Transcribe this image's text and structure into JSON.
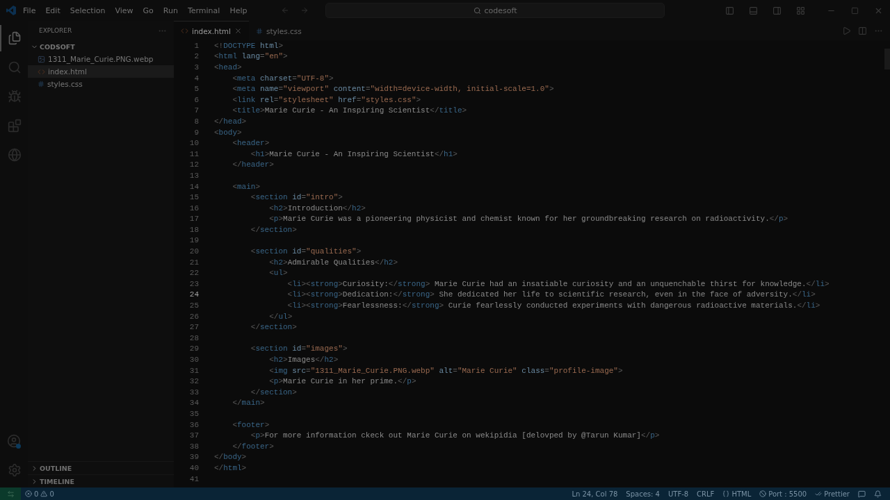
{
  "window": {
    "menu": [
      "File",
      "Edit",
      "Selection",
      "View",
      "Go",
      "Run",
      "Terminal",
      "Help"
    ],
    "search": "codesoft"
  },
  "activity_bar": [
    {
      "kind": "files",
      "selected": true
    },
    {
      "kind": "search",
      "selected": false
    },
    {
      "kind": "debug",
      "selected": false
    },
    {
      "kind": "extensions",
      "selected": false
    },
    {
      "kind": "browser",
      "selected": false
    }
  ],
  "sidebar": {
    "title": "EXPLORER",
    "folder": {
      "name": "CODSOFT",
      "expanded": true,
      "children": [
        {
          "name": "1311_Marie_Curie.PNG.webp",
          "kind": "image",
          "selected": false
        },
        {
          "name": "index.html",
          "kind": "html",
          "selected": true
        },
        {
          "name": "styles.css",
          "kind": "css",
          "selected": false
        }
      ]
    },
    "sections": [
      {
        "name": "OUTLINE",
        "expanded": false
      },
      {
        "name": "TIMELINE",
        "expanded": false
      }
    ]
  },
  "tabs": [
    {
      "label": "index.html",
      "kind": "html",
      "selected": true
    },
    {
      "label": "styles.css",
      "kind": "css",
      "selected": false
    }
  ],
  "editor": {
    "lines": [
      {
        "number": "1",
        "current": false,
        "tokens": [
          {
            "kind": "punct",
            "text": "<!"
          },
          {
            "kind": "tag",
            "text": "DOCTYPE"
          },
          {
            "kind": "attr",
            "text": " html"
          },
          {
            "kind": "punct",
            "text": ">"
          }
        ]
      },
      {
        "number": "2",
        "current": false,
        "tokens": [
          {
            "kind": "punct",
            "text": "<"
          },
          {
            "kind": "tag",
            "text": "html"
          },
          {
            "kind": "attr",
            "text": " lang"
          },
          {
            "kind": "punct",
            "text": "="
          },
          {
            "kind": "string",
            "text": "\"en\""
          },
          {
            "kind": "punct",
            "text": ">"
          }
        ]
      },
      {
        "number": "3",
        "current": false,
        "tokens": [
          {
            "kind": "punct",
            "text": "<"
          },
          {
            "kind": "tag",
            "text": "head"
          },
          {
            "kind": "punct",
            "text": ">"
          }
        ]
      },
      {
        "number": "4",
        "current": false,
        "tokens": [
          {
            "kind": "punct",
            "text": "    <"
          },
          {
            "kind": "tag",
            "text": "meta"
          },
          {
            "kind": "attr",
            "text": " charset"
          },
          {
            "kind": "punct",
            "text": "="
          },
          {
            "kind": "string",
            "text": "\"UTF-8\""
          },
          {
            "kind": "punct",
            "text": ">"
          }
        ]
      },
      {
        "number": "5",
        "current": false,
        "tokens": [
          {
            "kind": "punct",
            "text": "    <"
          },
          {
            "kind": "tag",
            "text": "meta"
          },
          {
            "kind": "attr",
            "text": " name"
          },
          {
            "kind": "punct",
            "text": "="
          },
          {
            "kind": "string",
            "text": "\"viewport\""
          },
          {
            "kind": "attr",
            "text": " content"
          },
          {
            "kind": "punct",
            "text": "="
          },
          {
            "kind": "string",
            "text": "\"width=device-width, initial-scale=1.0\""
          },
          {
            "kind": "punct",
            "text": ">"
          }
        ]
      },
      {
        "number": "6",
        "current": false,
        "tokens": [
          {
            "kind": "punct",
            "text": "    <"
          },
          {
            "kind": "tag",
            "text": "link"
          },
          {
            "kind": "attr",
            "text": " rel"
          },
          {
            "kind": "punct",
            "text": "="
          },
          {
            "kind": "string",
            "text": "\"stylesheet\""
          },
          {
            "kind": "attr",
            "text": " href"
          },
          {
            "kind": "punct",
            "text": "="
          },
          {
            "kind": "string",
            "text": "\"styles.css\""
          },
          {
            "kind": "punct",
            "text": ">"
          }
        ]
      },
      {
        "number": "7",
        "current": false,
        "tokens": [
          {
            "kind": "punct",
            "text": "    <"
          },
          {
            "kind": "tag",
            "text": "title"
          },
          {
            "kind": "punct",
            "text": ">"
          },
          {
            "kind": "text",
            "text": "Marie Curie - An Inspiring Scientist"
          },
          {
            "kind": "punct",
            "text": "</"
          },
          {
            "kind": "tag",
            "text": "title"
          },
          {
            "kind": "punct",
            "text": ">"
          }
        ]
      },
      {
        "number": "8",
        "current": false,
        "tokens": [
          {
            "kind": "punct",
            "text": "</"
          },
          {
            "kind": "tag",
            "text": "head"
          },
          {
            "kind": "punct",
            "text": ">"
          }
        ]
      },
      {
        "number": "9",
        "current": false,
        "tokens": [
          {
            "kind": "punct",
            "text": "<"
          },
          {
            "kind": "tag",
            "text": "body"
          },
          {
            "kind": "punct",
            "text": ">"
          }
        ]
      },
      {
        "number": "10",
        "current": false,
        "tokens": [
          {
            "kind": "punct",
            "text": "    <"
          },
          {
            "kind": "tag",
            "text": "header"
          },
          {
            "kind": "punct",
            "text": ">"
          }
        ]
      },
      {
        "number": "11",
        "current": false,
        "tokens": [
          {
            "kind": "punct",
            "text": "        <"
          },
          {
            "kind": "tag",
            "text": "h1"
          },
          {
            "kind": "punct",
            "text": ">"
          },
          {
            "kind": "text",
            "text": "Marie Curie - An Inspiring Scientist"
          },
          {
            "kind": "punct",
            "text": "</"
          },
          {
            "kind": "tag",
            "text": "h1"
          },
          {
            "kind": "punct",
            "text": ">"
          }
        ]
      },
      {
        "number": "12",
        "current": false,
        "tokens": [
          {
            "kind": "punct",
            "text": "    </"
          },
          {
            "kind": "tag",
            "text": "header"
          },
          {
            "kind": "punct",
            "text": ">"
          }
        ]
      },
      {
        "number": "13",
        "current": false
      },
      {
        "number": "14",
        "current": false,
        "tokens": [
          {
            "kind": "punct",
            "text": "    <"
          },
          {
            "kind": "tag",
            "text": "main"
          },
          {
            "kind": "punct",
            "text": ">"
          }
        ]
      },
      {
        "number": "15",
        "current": false,
        "tokens": [
          {
            "kind": "punct",
            "text": "        <"
          },
          {
            "kind": "tag",
            "text": "section"
          },
          {
            "kind": "attr",
            "text": " id"
          },
          {
            "kind": "punct",
            "text": "="
          },
          {
            "kind": "string",
            "text": "\"intro\""
          },
          {
            "kind": "punct",
            "text": ">"
          }
        ]
      },
      {
        "number": "16",
        "current": false,
        "tokens": [
          {
            "kind": "punct",
            "text": "            <"
          },
          {
            "kind": "tag",
            "text": "h2"
          },
          {
            "kind": "punct",
            "text": ">"
          },
          {
            "kind": "text",
            "text": "Introduction"
          },
          {
            "kind": "punct",
            "text": "</"
          },
          {
            "kind": "tag",
            "text": "h2"
          },
          {
            "kind": "punct",
            "text": ">"
          }
        ]
      },
      {
        "number": "17",
        "current": false,
        "tokens": [
          {
            "kind": "punct",
            "text": "            <"
          },
          {
            "kind": "tag",
            "text": "p"
          },
          {
            "kind": "punct",
            "text": ">"
          },
          {
            "kind": "text",
            "text": "Marie Curie was a pioneering physicist and chemist known for her groundbreaking research on radioactivity."
          },
          {
            "kind": "punct",
            "text": "</"
          },
          {
            "kind": "tag",
            "text": "p"
          },
          {
            "kind": "punct",
            "text": ">"
          }
        ]
      },
      {
        "number": "18",
        "current": false,
        "tokens": [
          {
            "kind": "punct",
            "text": "        </"
          },
          {
            "kind": "tag",
            "text": "section"
          },
          {
            "kind": "punct",
            "text": ">"
          }
        ]
      },
      {
        "number": "19",
        "current": false
      },
      {
        "number": "20",
        "current": false,
        "tokens": [
          {
            "kind": "punct",
            "text": "        <"
          },
          {
            "kind": "tag",
            "text": "section"
          },
          {
            "kind": "attr",
            "text": " id"
          },
          {
            "kind": "punct",
            "text": "="
          },
          {
            "kind": "string",
            "text": "\"qualities\""
          },
          {
            "kind": "punct",
            "text": ">"
          }
        ]
      },
      {
        "number": "21",
        "current": false,
        "tokens": [
          {
            "kind": "punct",
            "text": "            <"
          },
          {
            "kind": "tag",
            "text": "h2"
          },
          {
            "kind": "punct",
            "text": ">"
          },
          {
            "kind": "text",
            "text": "Admirable Qualities"
          },
          {
            "kind": "punct",
            "text": "</"
          },
          {
            "kind": "tag",
            "text": "h2"
          },
          {
            "kind": "punct",
            "text": ">"
          }
        ]
      },
      {
        "number": "22",
        "current": false,
        "tokens": [
          {
            "kind": "punct",
            "text": "            <"
          },
          {
            "kind": "tag",
            "text": "ul"
          },
          {
            "kind": "punct",
            "text": ">"
          }
        ]
      },
      {
        "number": "23",
        "current": false,
        "tokens": [
          {
            "kind": "punct",
            "text": "                <"
          },
          {
            "kind": "tag",
            "text": "li"
          },
          {
            "kind": "punct",
            "text": "><"
          },
          {
            "kind": "tag",
            "text": "strong"
          },
          {
            "kind": "punct",
            "text": ">"
          },
          {
            "kind": "text",
            "text": "Curiosity:"
          },
          {
            "kind": "punct",
            "text": "</"
          },
          {
            "kind": "tag",
            "text": "strong"
          },
          {
            "kind": "punct",
            "text": ">"
          },
          {
            "kind": "text",
            "text": " Marie Curie had an insatiable curiosity and an unquenchable thirst for knowledge."
          },
          {
            "kind": "punct",
            "text": "</"
          },
          {
            "kind": "tag",
            "text": "li"
          },
          {
            "kind": "punct",
            "text": ">"
          }
        ]
      },
      {
        "number": "24",
        "current": true,
        "tokens": [
          {
            "kind": "punct",
            "text": "                <"
          },
          {
            "kind": "tag",
            "text": "li"
          },
          {
            "kind": "punct",
            "text": "><"
          },
          {
            "kind": "tag",
            "text": "strong"
          },
          {
            "kind": "punct",
            "text": ">"
          },
          {
            "kind": "text",
            "text": "Dedication:"
          },
          {
            "kind": "punct",
            "text": "</"
          },
          {
            "kind": "tag",
            "text": "strong"
          },
          {
            "kind": "punct",
            "text": ">"
          },
          {
            "kind": "text",
            "text": " She dedicated her life to scientific research, even in the face of adversity."
          },
          {
            "kind": "punct",
            "text": "</"
          },
          {
            "kind": "tag",
            "text": "li"
          },
          {
            "kind": "punct",
            "text": ">"
          }
        ]
      },
      {
        "number": "25",
        "current": false,
        "tokens": [
          {
            "kind": "punct",
            "text": "                <"
          },
          {
            "kind": "tag",
            "text": "li"
          },
          {
            "kind": "punct",
            "text": "><"
          },
          {
            "kind": "tag",
            "text": "strong"
          },
          {
            "kind": "punct",
            "text": ">"
          },
          {
            "kind": "text",
            "text": "Fearlessness:"
          },
          {
            "kind": "punct",
            "text": "</"
          },
          {
            "kind": "tag",
            "text": "strong"
          },
          {
            "kind": "punct",
            "text": ">"
          },
          {
            "kind": "text",
            "text": " Curie fearlessly conducted experiments with dangerous radioactive materials."
          },
          {
            "kind": "punct",
            "text": "</"
          },
          {
            "kind": "tag",
            "text": "li"
          },
          {
            "kind": "punct",
            "text": ">"
          }
        ]
      },
      {
        "number": "26",
        "current": false,
        "tokens": [
          {
            "kind": "punct",
            "text": "            </"
          },
          {
            "kind": "tag",
            "text": "ul"
          },
          {
            "kind": "punct",
            "text": ">"
          }
        ]
      },
      {
        "number": "27",
        "current": false,
        "tokens": [
          {
            "kind": "punct",
            "text": "        </"
          },
          {
            "kind": "tag",
            "text": "section"
          },
          {
            "kind": "punct",
            "text": ">"
          }
        ]
      },
      {
        "number": "28",
        "current": false
      },
      {
        "number": "29",
        "current": false,
        "tokens": [
          {
            "kind": "punct",
            "text": "        <"
          },
          {
            "kind": "tag",
            "text": "section"
          },
          {
            "kind": "attr",
            "text": " id"
          },
          {
            "kind": "punct",
            "text": "="
          },
          {
            "kind": "string",
            "text": "\"images\""
          },
          {
            "kind": "punct",
            "text": ">"
          }
        ]
      },
      {
        "number": "30",
        "current": false,
        "tokens": [
          {
            "kind": "punct",
            "text": "            <"
          },
          {
            "kind": "tag",
            "text": "h2"
          },
          {
            "kind": "punct",
            "text": ">"
          },
          {
            "kind": "text",
            "text": "Images"
          },
          {
            "kind": "punct",
            "text": "</"
          },
          {
            "kind": "tag",
            "text": "h2"
          },
          {
            "kind": "punct",
            "text": ">"
          }
        ]
      },
      {
        "number": "31",
        "current": false,
        "tokens": [
          {
            "kind": "punct",
            "text": "            <"
          },
          {
            "kind": "tag",
            "text": "img"
          },
          {
            "kind": "attr",
            "text": " src"
          },
          {
            "kind": "punct",
            "text": "="
          },
          {
            "kind": "string",
            "text": "\"1311_Marie_Curie.PNG.webp\""
          },
          {
            "kind": "attr",
            "text": " alt"
          },
          {
            "kind": "punct",
            "text": "="
          },
          {
            "kind": "string",
            "text": "\"Marie Curie\""
          },
          {
            "kind": "attr",
            "text": " class"
          },
          {
            "kind": "punct",
            "text": "="
          },
          {
            "kind": "string",
            "text": "\"profile-image\""
          },
          {
            "kind": "punct",
            "text": ">"
          }
        ]
      },
      {
        "number": "32",
        "current": false,
        "tokens": [
          {
            "kind": "punct",
            "text": "            <"
          },
          {
            "kind": "tag",
            "text": "p"
          },
          {
            "kind": "punct",
            "text": ">"
          },
          {
            "kind": "text",
            "text": "Marie Curie in her prime."
          },
          {
            "kind": "punct",
            "text": "</"
          },
          {
            "kind": "tag",
            "text": "p"
          },
          {
            "kind": "punct",
            "text": ">"
          }
        ]
      },
      {
        "number": "33",
        "current": false,
        "tokens": [
          {
            "kind": "punct",
            "text": "        </"
          },
          {
            "kind": "tag",
            "text": "section"
          },
          {
            "kind": "punct",
            "text": ">"
          }
        ]
      },
      {
        "number": "34",
        "current": false,
        "tokens": [
          {
            "kind": "punct",
            "text": "    </"
          },
          {
            "kind": "tag",
            "text": "main"
          },
          {
            "kind": "punct",
            "text": ">"
          }
        ]
      },
      {
        "number": "35",
        "current": false
      },
      {
        "number": "36",
        "current": false,
        "tokens": [
          {
            "kind": "punct",
            "text": "    <"
          },
          {
            "kind": "tag",
            "text": "footer"
          },
          {
            "kind": "punct",
            "text": ">"
          }
        ]
      },
      {
        "number": "37",
        "current": false,
        "tokens": [
          {
            "kind": "punct",
            "text": "        <"
          },
          {
            "kind": "tag",
            "text": "p"
          },
          {
            "kind": "punct",
            "text": ">"
          },
          {
            "kind": "text",
            "text": "For more information ckeck out Marie Curie on wekipidia [delovped by @Tarun Kumar]"
          },
          {
            "kind": "punct",
            "text": "</"
          },
          {
            "kind": "tag",
            "text": "p"
          },
          {
            "kind": "punct",
            "text": ">"
          }
        ]
      },
      {
        "number": "38",
        "current": false,
        "tokens": [
          {
            "kind": "punct",
            "text": "    </"
          },
          {
            "kind": "tag",
            "text": "footer"
          },
          {
            "kind": "punct",
            "text": ">"
          }
        ]
      },
      {
        "number": "39",
        "current": false,
        "tokens": [
          {
            "kind": "punct",
            "text": "</"
          },
          {
            "kind": "tag",
            "text": "body"
          },
          {
            "kind": "punct",
            "text": ">"
          }
        ]
      },
      {
        "number": "40",
        "current": false,
        "tokens": [
          {
            "kind": "punct",
            "text": "</"
          },
          {
            "kind": "tag",
            "text": "html"
          },
          {
            "kind": "punct",
            "text": ">"
          }
        ]
      },
      {
        "number": "41",
        "current": false
      }
    ]
  },
  "status_bar": {
    "errors": "0",
    "warnings": "0",
    "items": [
      {
        "kind": "plain",
        "text": "Ln 24, Col 78"
      },
      {
        "kind": "plain",
        "text": "Spaces: 4"
      },
      {
        "kind": "plain",
        "text": "UTF-8"
      },
      {
        "kind": "plain",
        "text": "CRLF"
      },
      {
        "kind": "language",
        "text": "HTML"
      },
      {
        "kind": "port",
        "text": "Port : 5500"
      },
      {
        "kind": "formatter",
        "text": "Prettier"
      }
    ]
  }
}
